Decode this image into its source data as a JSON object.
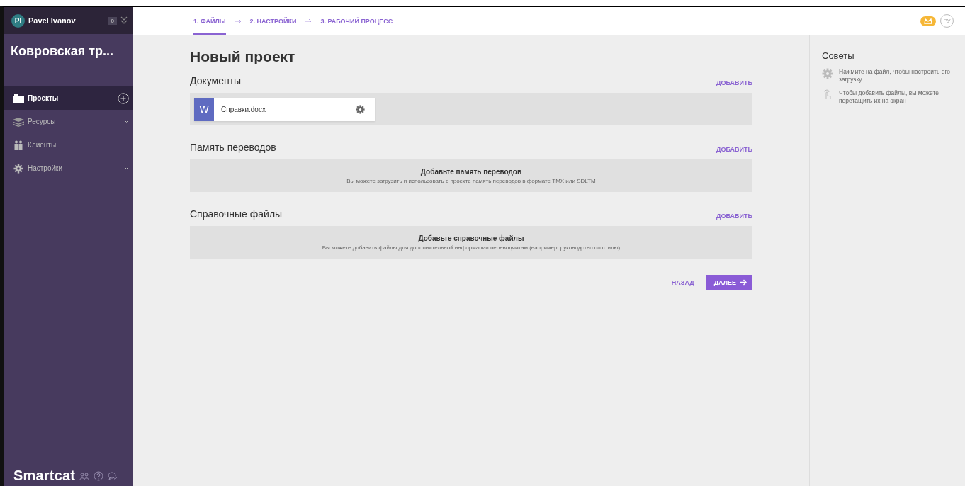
{
  "user": {
    "initials": "PI",
    "name": "Pavel Ivanov",
    "count": "0"
  },
  "workspace": {
    "title": "Ковровская тр..."
  },
  "sidebar": {
    "items": [
      {
        "label": "Проекты",
        "selected": true
      },
      {
        "label": "Ресурсы",
        "selected": false
      },
      {
        "label": "Клиенты",
        "selected": false
      },
      {
        "label": "Настройки",
        "selected": false
      }
    ]
  },
  "logo": "Smartcat",
  "steps": [
    {
      "label": "1. ФАЙЛЫ",
      "selected": true
    },
    {
      "label": "2. НАСТРОЙКИ",
      "selected": false
    },
    {
      "label": "3. РАБОЧИЙ ПРОЦЕСС",
      "selected": false
    }
  ],
  "language": "РУ",
  "page_title": "Новый проект",
  "sections": [
    {
      "title": "Документы",
      "add": "ДОБАВИТЬ",
      "files": [
        {
          "type": "W",
          "name": "Справки.docx"
        }
      ]
    },
    {
      "title": "Память переводов",
      "add": "ДОБАВИТЬ",
      "empty_title": "Добавьте память переводов",
      "empty_text": "Вы можете загрузить и использовать в проекте память переводов в формате TMX или SDLTM"
    },
    {
      "title": "Справочные файлы",
      "add": "ДОБАВИТЬ",
      "empty_title": "Добавьте справочные файлы",
      "empty_text": "Вы можете добавить файлы для дополнительной информации переводчикам (например, руководство по стилю)"
    }
  ],
  "buttons": {
    "back": "НАЗАД",
    "next": "ДАЛЕЕ"
  },
  "tips": {
    "title": "Советы",
    "items": [
      {
        "text": "Нажмите на файл, чтобы настроить его загрузку"
      },
      {
        "text": "Чтобы добавить файлы, вы можете перетащить их на экран"
      }
    ]
  }
}
